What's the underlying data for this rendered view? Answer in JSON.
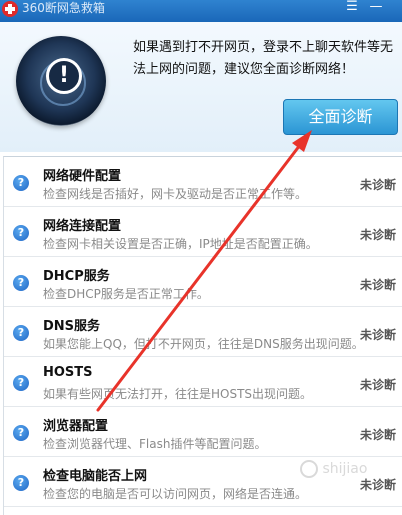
{
  "window": {
    "title": "360断网急救箱",
    "menu_glyph": "☰",
    "minimize_glyph": "—"
  },
  "header": {
    "intro_text": "如果遇到打不开网页，登录不上聊天软件等无法上网的问题，建议您全面诊断网络！",
    "diagnose_button": "全面诊断",
    "alert_glyph": "!"
  },
  "items": [
    {
      "title": "网络硬件配置",
      "desc": "检查网线是否插好，网卡及驱动是否正常工作等。",
      "status": "未诊断"
    },
    {
      "title": "网络连接配置",
      "desc": "检查网卡相关设置是否正确，IP地址是否配置正确。",
      "status": "未诊断"
    },
    {
      "title": "DHCP服务",
      "desc": "检查DHCP服务是否正常工作。",
      "status": "未诊断"
    },
    {
      "title": "DNS服务",
      "desc": "如果您能上QQ，但打不开网页，往往是DNS服务出现问题。",
      "status": "未诊断"
    },
    {
      "title": "HOSTS",
      "desc": "如果有些网页无法打开，往往是HOSTS出现问题。",
      "status": "未诊断"
    },
    {
      "title": "浏览器配置",
      "desc": "检查浏览器代理、Flash插件等配置问题。",
      "status": "未诊断"
    },
    {
      "title": "检查电脑能否上网",
      "desc": "检查您的电脑是否可以访问网页，网络是否连通。",
      "status": "未诊断"
    }
  ],
  "item_icon_glyph": "?",
  "watermark": "shijiao",
  "colors": {
    "accent": "#2b95d4",
    "titlebar": "#1a67b8",
    "annotation_arrow": "#e8332a",
    "status_text": "#555555"
  },
  "icons": {
    "logo": "360-logo-icon",
    "status": "question-icon",
    "radar": "radar-alert-icon"
  }
}
